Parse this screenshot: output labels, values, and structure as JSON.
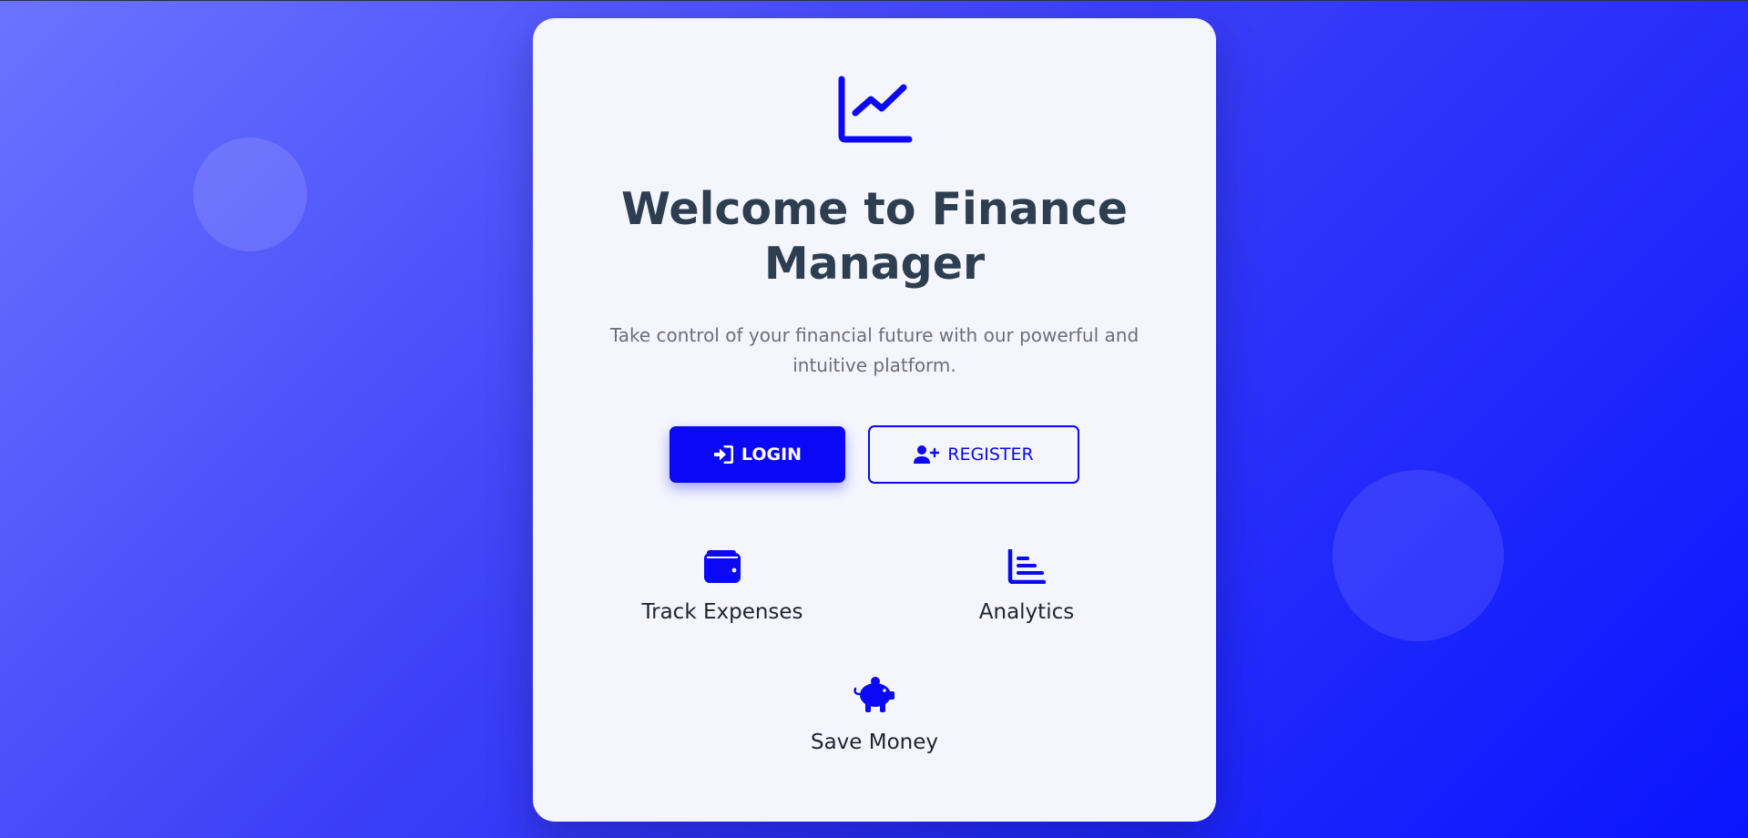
{
  "app": {
    "title_line1": "Welcome to Finance",
    "title_line2": "Manager",
    "subtitle_line1": "Take control of your financial future with our powerful and",
    "subtitle_line2": "intuitive platform.",
    "logo_icon": "chart-line-icon"
  },
  "actions": {
    "login_label": "LOGIN",
    "login_icon": "sign-in-icon",
    "register_label": "REGISTER",
    "register_icon": "user-plus-icon"
  },
  "features": [
    {
      "label": "Track Expenses",
      "icon": "wallet-icon"
    },
    {
      "label": "Analytics",
      "icon": "bar-chart-icon"
    },
    {
      "label": "Save Money",
      "icon": "piggy-bank-icon"
    }
  ],
  "colors": {
    "accent": "#0a08f5",
    "heading": "#2c3e50",
    "card": "#f4f5fd",
    "background_start": "#6b73ff",
    "background_end": "#0a14ff"
  }
}
